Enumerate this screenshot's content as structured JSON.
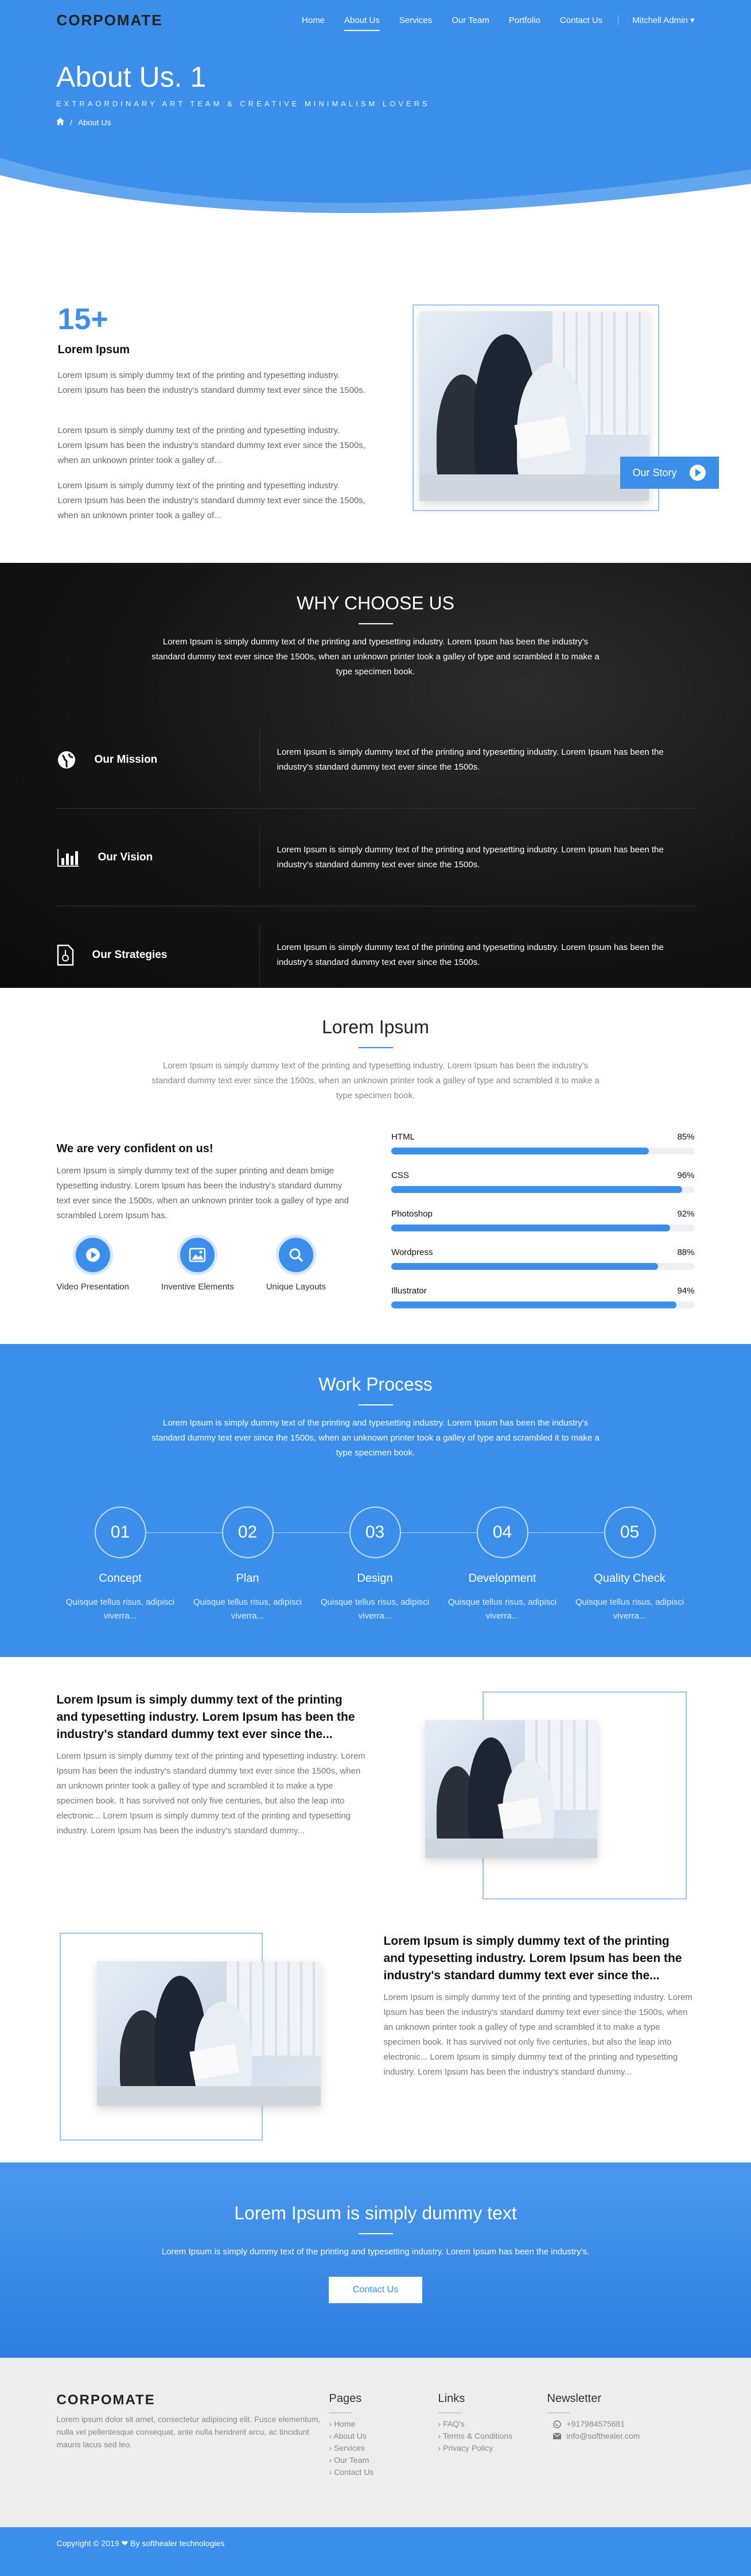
{
  "header": {
    "logo": "CORPOMATE",
    "nav": [
      "Home",
      "About Us",
      "Services",
      "Our Team",
      "Portfolio",
      "Contact Us"
    ],
    "active_nav": "About Us",
    "user": "Mitchell Admin ▾",
    "title": "About Us. 1",
    "subtitle": "EXTRAORDINARY ART TEAM & CREATIVE MINIMALISM LOVERS",
    "breadcrumb_current": "About Us"
  },
  "about": {
    "number": "15+",
    "heading": "Lorem Ipsum",
    "paragraphs": [
      "Lorem Ipsum is simply dummy text of the printing and typesetting industry. Lorem Ipsum has been the industry's standard dummy text ever since the 1500s.",
      "Lorem Ipsum is simply dummy text of the printing and typesetting industry. Lorem Ipsum has been the industry's standard dummy text ever since the 1500s, when an unknown printer took a galley of...",
      "Lorem Ipsum is simply dummy text of the printing and typesetting industry. Lorem Ipsum has been the industry's standard dummy text ever since the 1500s, when an unknown printer took a galley of..."
    ],
    "story_button": "Our Story"
  },
  "why": {
    "title": "WHY CHOOSE US",
    "text": "Lorem Ipsum is simply dummy text of the printing and typesetting industry. Lorem Ipsum has been the industry's standard dummy text ever since the 1500s, when an unknown printer took a galley of type and scrambled it to make a type specimen book.",
    "rows": [
      {
        "label": "Our Mission",
        "icon": "globe-icon",
        "text": "Lorem Ipsum is simply dummy text of the printing and typesetting industry. Lorem Ipsum has been the industry's standard dummy text ever since the 1500s."
      },
      {
        "label": "Our Vision",
        "icon": "bar-chart-icon",
        "text": "Lorem Ipsum is simply dummy text of the printing and typesetting industry. Lorem Ipsum has been the industry's standard dummy text ever since the 1500s."
      },
      {
        "label": "Our Strategies",
        "icon": "document-icon",
        "text": "Lorem Ipsum is simply dummy text of the printing and typesetting industry. Lorem Ipsum has been the industry's standard dummy text ever since the 1500s."
      }
    ]
  },
  "skills": {
    "title": "Lorem Ipsum",
    "text": "Lorem Ipsum is simply dummy text of the printing and typesetting industry. Lorem Ipsum has been the industry's standard dummy text ever since the 1500s, when an unknown printer took a galley of type and scrambled it to make a type specimen book.",
    "confident_heading": "We are very confident on us!",
    "confident_text": "Lorem Ipsum is simply dummy text of the super printing and deam bmige typesetting industry. Lorem Ipsum has been the industry's standard dummy text ever since the 1500s, when an unknown printer took a galley of type and scrambled Lorem Ipsum has.",
    "features": [
      {
        "label": "Video Presentation",
        "icon": "play-icon"
      },
      {
        "label": "Inventive Elements",
        "icon": "image-icon"
      },
      {
        "label": "Unique Layouts",
        "icon": "search-icon"
      }
    ],
    "bars": [
      {
        "name": "HTML",
        "percent": 85,
        "label": "85%"
      },
      {
        "name": "CSS",
        "percent": 96,
        "label": "96%"
      },
      {
        "name": "Photoshop",
        "percent": 92,
        "label": "92%"
      },
      {
        "name": "Wordpress",
        "percent": 88,
        "label": "88%"
      },
      {
        "name": "Illustrator",
        "percent": 94,
        "label": "94%"
      }
    ]
  },
  "work": {
    "title": "Work Process",
    "text": "Lorem Ipsum is simply dummy text of the printing and typesetting industry. Lorem Ipsum has been the industry's standard dummy text ever since the 1500s, when an unknown printer took a galley of type and scrambled it to make a type specimen book.",
    "steps": [
      {
        "num": "01",
        "title": "Concept",
        "text": "Quisque tellus risus, adipisci viverra..."
      },
      {
        "num": "02",
        "title": "Plan",
        "text": "Quisque tellus risus, adipisci viverra..."
      },
      {
        "num": "03",
        "title": "Design",
        "text": "Quisque tellus risus, adipisci viverra..."
      },
      {
        "num": "04",
        "title": "Development",
        "text": "Quisque tellus risus, adipisci viverra..."
      },
      {
        "num": "05",
        "title": "Quality Check",
        "text": "Quisque tellus risus, adipisci viverra..."
      }
    ]
  },
  "blocks": [
    {
      "heading": "Lorem Ipsum is simply dummy text of the printing and typesetting industry. Lorem Ipsum has been the industry's standard dummy text ever since the...",
      "text": "Lorem Ipsum is simply dummy text of the printing and typesetting industry. Lorem Ipsum has been the industry's standard dummy text ever since the 1500s, when an unknown printer took a galley of type and scrambled it to make a type specimen book. It has survived not only five centuries, but also the leap into electronic... Lorem Ipsum is simply dummy text of the printing and typesetting industry. Lorem Ipsum has been the industry's standard dummy..."
    },
    {
      "heading": "Lorem Ipsum is simply dummy text of the printing and typesetting industry. Lorem Ipsum has been the industry's standard dummy text ever since the...",
      "text": "Lorem Ipsum is simply dummy text of the printing and typesetting industry. Lorem Ipsum has been the industry's standard dummy text ever since the 1500s, when an unknown printer took a galley of type and scrambled it to make a type specimen book. It has survived not only five centuries, but also the leap into electronic... Lorem Ipsum is simply dummy text of the printing and typesetting industry. Lorem Ipsum has been the industry's standard dummy..."
    }
  ],
  "cta": {
    "title": "Lorem Ipsum is simply dummy text",
    "text": "Lorem Ipsum is simply dummy text of the printing and typesetting industry. Lorem Ipsum has been the industry's.",
    "button": "Contact Us"
  },
  "footer": {
    "logo": "CORPOMATE",
    "about": "Lorem ipsum dolor sit amet, consectetur adipiscing elit. Fusce elementum, nulla vel pellentesque consequat, ante nulla hendrerit arcu, ac tincidunt mauris lacus sed leo.",
    "pages_title": "Pages",
    "pages": [
      "Home",
      "About Us",
      "Services",
      "Our Team",
      "Contact Us"
    ],
    "links_title": "Links",
    "links": [
      "FAQ's",
      "Terms & Conditions",
      "Privacy Policy"
    ],
    "news_title": "Newsletter",
    "phone": "+917984575681",
    "email": "info@softhealer.com",
    "copyright": "Copyright © 2019 ❤ By softhealer technologies"
  },
  "colors": {
    "accent": "#3b8eea",
    "dark": "#111111",
    "footer_bg": "#ededed"
  }
}
